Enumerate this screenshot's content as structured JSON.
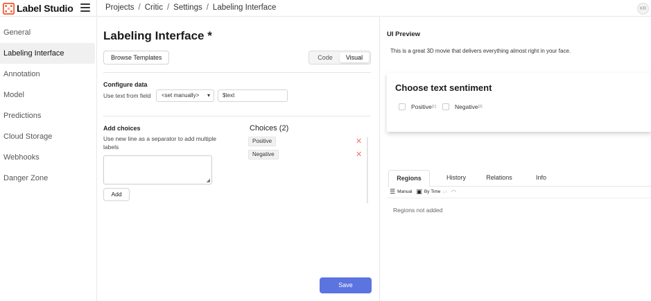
{
  "app": {
    "name": "Label Studio",
    "brand_color": "#f2542d",
    "avatar": "KR"
  },
  "breadcrumb": [
    "Projects",
    "Critic",
    "Settings",
    "Labeling Interface"
  ],
  "sidebar": {
    "items": [
      {
        "label": "General",
        "active": false
      },
      {
        "label": "Labeling Interface",
        "active": true
      },
      {
        "label": "Annotation",
        "active": false
      },
      {
        "label": "Model",
        "active": false
      },
      {
        "label": "Predictions",
        "active": false
      },
      {
        "label": "Cloud Storage",
        "active": false
      },
      {
        "label": "Webhooks",
        "active": false
      },
      {
        "label": "Danger Zone",
        "active": false
      }
    ]
  },
  "main": {
    "title": "Labeling Interface *",
    "browse_templates": "Browse Templates",
    "view_toggle": {
      "code": "Code",
      "visual": "Visual",
      "selected": "Visual"
    },
    "configure_data": {
      "heading": "Configure data",
      "label": "Use text from field",
      "select_value": "<set manually>",
      "field_value": "$text"
    },
    "add_choices": {
      "heading": "Add choices",
      "hint": "Use new line as a separator to add multiple labels",
      "textarea_value": "",
      "add_button": "Add"
    },
    "choices": {
      "title": "Choices (2)",
      "items": [
        "Positive",
        "Negative"
      ]
    },
    "save_button": "Save",
    "accent_color": "#5b74e0"
  },
  "preview": {
    "title": "UI Preview",
    "sample_text": "This is a great 3D movie that delivers everything almost right in your face.",
    "card_title": "Choose text sentiment",
    "options": [
      {
        "label": "Positive",
        "hotkey": "[1]"
      },
      {
        "label": "Negative",
        "hotkey": "[2]"
      }
    ],
    "tabs": [
      "Regions",
      "History",
      "Relations",
      "Info"
    ],
    "active_tab": "Regions",
    "tools": {
      "manual": "Manual",
      "by_time": "By Time"
    },
    "empty_text": "Regions not added"
  }
}
